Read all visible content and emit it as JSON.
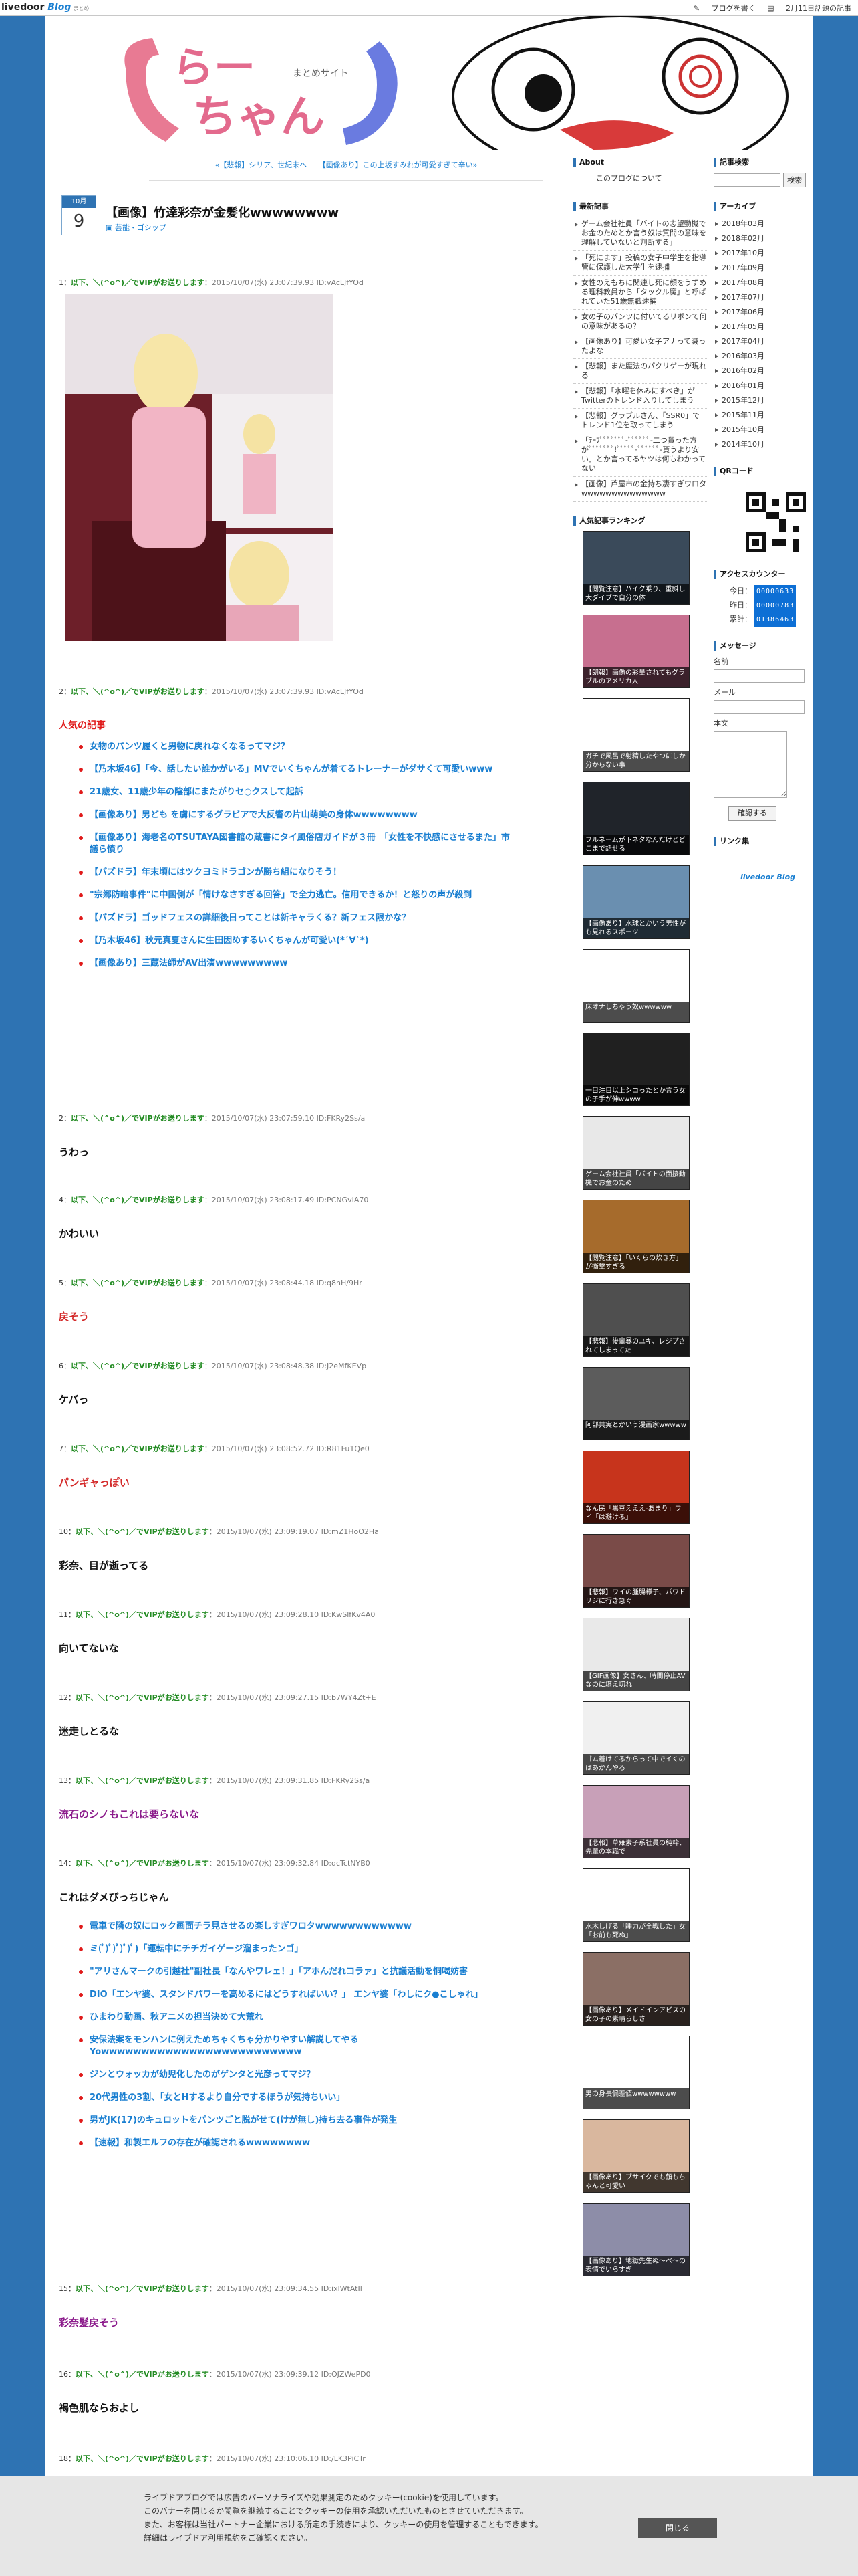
{
  "topbar": {
    "logo_text": "livedoor",
    "logo_blog": "Blog",
    "logo_sub": "まとめ",
    "write": "ブログを書く",
    "date_link": "2月11日話題の記事"
  },
  "header": {
    "title_line1": "らー",
    "title_line2": "ちゃん",
    "subtitle": "まとめサイト"
  },
  "prevnext": {
    "prev": "«【悲報】シリア、世紀末へ",
    "next": "【画像あり】この上坂すみれが可愛すぎて辛い»"
  },
  "article": {
    "month": "10月",
    "day": "9",
    "title": "【画像】竹達彩奈が金髪化wwwwwwww",
    "category": "芸能・ゴシップ"
  },
  "responses": [
    {
      "num": "1：",
      "name": "以下、＼(^o^)／でVIPがお送りします",
      "meta": "：2015/10/07(水) 23:07:39.93 ID:vAcLJfYOd",
      "body": "",
      "color": "#111"
    },
    {
      "num": "2：",
      "name": "以下、＼(^o^)／でVIPがお送りします",
      "meta": "：2015/10/07(水) 23:07:39.93 ID:vAcLJfYOd",
      "body": "",
      "color": "#111"
    },
    {
      "num": "2：",
      "name": "以下、＼(^o^)／でVIPがお送りします",
      "meta": "：2015/10/07(水) 23:07:59.10 ID:FKRy2Ss/a",
      "body": "うわっ",
      "color": "#111"
    },
    {
      "num": "4：",
      "name": "以下、＼(^o^)／でVIPがお送りします",
      "meta": "：2015/10/07(水) 23:08:17.49 ID:PCNGvIA70",
      "body": "かわいい",
      "color": "#111"
    },
    {
      "num": "5：",
      "name": "以下、＼(^o^)／でVIPがお送りします",
      "meta": "：2015/10/07(水) 23:08:44.18 ID:q8nH/9Hr",
      "body": "戻そう",
      "color": "#d42b2b"
    },
    {
      "num": "6：",
      "name": "以下、＼(^o^)／でVIPがお送りします",
      "meta": "：2015/10/07(水) 23:08:48.38 ID:J2eMfKEVp",
      "body": "ケバっ",
      "color": "#111"
    },
    {
      "num": "7：",
      "name": "以下、＼(^o^)／でVIPがお送りします",
      "meta": "：2015/10/07(水) 23:08:52.72 ID:R81Fu1Qe0",
      "body": "パンギャっぽい",
      "color": "#d42b2b"
    },
    {
      "num": "10：",
      "name": "以下、＼(^o^)／でVIPがお送りします",
      "meta": "：2015/10/07(水) 23:09:19.07 ID:mZ1HoO2Ha",
      "body": "彩奈、目が逝ってる",
      "color": "#111"
    },
    {
      "num": "11：",
      "name": "以下、＼(^o^)／でVIPがお送りします",
      "meta": "：2015/10/07(水) 23:09:28.10 ID:KwSlfKv4A0",
      "body": "向いてないな",
      "color": "#111"
    },
    {
      "num": "12：",
      "name": "以下、＼(^o^)／でVIPがお送りします",
      "meta": "：2015/10/07(水) 23:09:27.15 ID:b7WY4Zt+E",
      "body": "迷走しとるな",
      "color": "#111"
    },
    {
      "num": "13：",
      "name": "以下、＼(^o^)／でVIPがお送りします",
      "meta": "：2015/10/07(水) 23:09:31.85 ID:FKRy2Ss/a",
      "body": "流石のシノもこれは要らないな",
      "color": "#8b1a8b"
    },
    {
      "num": "14：",
      "name": "以下、＼(^o^)／でVIPがお送りします",
      "meta": "：2015/10/07(水) 23:09:32.84 ID:qcTctNYB0",
      "body": "これはダメびっちじゃん",
      "color": "#111"
    },
    {
      "num": "15：",
      "name": "以下、＼(^o^)／でVIPがお送りします",
      "meta": "：2015/10/07(水) 23:09:34.55 ID:ixlWtAtIl",
      "body": "彩奈髪戻そう",
      "color": "#8b1a8b"
    },
    {
      "num": "16：",
      "name": "以下、＼(^o^)／でVIPがお送りします",
      "meta": "：2015/10/07(水) 23:09:39.12 ID:OJZWePD0",
      "body": "褐色肌ならおよし",
      "color": "#111"
    },
    {
      "num": "18：",
      "name": "以下、＼(^o^)／でVIPがお送りします",
      "meta": "：2015/10/07(水) 23:10:06.10 ID:/LK3PiCTr",
      "body": "",
      "color": "#111"
    }
  ],
  "popular": {
    "title": "人気の記事",
    "items": [
      "女物のパンツ履くと男物に戻れなくなるってマジ？",
      "【乃木坂46】「今、話したい誰かがいる」MVでいくちゃんが着てるトレーナーがダサくて可愛いwww",
      "21歳女、11歳少年の陰部にまたがりセ○クスして起訴",
      "【画像あり】男ども を虜にするグラビアで大反響の片山萌美の身体wwwwwwww",
      "【画像あり】海老名のTSUTAYA図書館の蔵書にタイ風俗店ガイドが３冊　「女性を不快感にさせるまた」市議ら憤り",
      "【パズドラ】年末頃にはツクヨミドラゴンが勝ち組になりそう！",
      "\"宗郷防暗事件\"に中国側が「情けなさすぎる回答」で全力逃亡。信用できるか！と怒りの声が殺到",
      "【パズドラ】ゴッドフェスの詳細後日ってことは新キャラくる？新フェス限かな？",
      "【乃木坂46】秋元真夏さんに生田因めするいくちゃんが可愛い(*´∀`*)",
      "【画像あり】三蔵法師がAV出演wwwwwwwww"
    ]
  },
  "second_links": [
    "電車で隣の奴にロック画面チラ見させるの楽しすぎワロタwwwwwwwwwwww",
    "ミ(ﾟ)ﾟ)ﾟ)ﾟ)ﾟ)「運転中にチチガイゲージ溜まったンゴ」",
    "\"アリさんマークの引越社\"副社長「なんやワレェ！」「アホんだれコラァ」と抗議活動を恫喝妨害",
    "DIO「エンヤ婆、スタンドパワーを高めるにはどうすればいい？」 エンヤ婆「わしにク●こしゃれ」",
    "ひまわり動画、秋アニメの担当決めて大荒れ",
    "安保法案をモンハンに例えためちゃくちゃ分かりやすい解説してやるYowwwwwwwwwwwwwwwwwwwwwwwww",
    "ジンとウォッカが幼児化したのがゲンタと光彦ってマジ？",
    "20代男性の3割、「女とHするより自分でするほうが気持ちいい」",
    "男がJK(17)のキュロットをパンツごと脱がせて(けが無し)持ち去る事件が発生",
    "【速報】和製エルフの存在が確認されるwwwwwwww"
  ],
  "side1": {
    "about_title": "About",
    "about_text": "このブログについて",
    "recent_title": "最新記事",
    "recent": [
      "ゲーム会社社員「バイトの志望動機でお金のためとか言う奴は質問の意味を理解していないと判断する」",
      "「死にます」投稿の女子中学生を指導管に保護した大学生を逮捕",
      "女性のえもちに関連し死に顔をうずめる理科教員から「タックル魔」と呼ばれていた51歳無職逮捕",
      "女の子のパンツに付いてるリボンて何の意味があるの？",
      "【画像あり】可愛い女子アナって減ったよな",
      "【悲報】また魔法のパクリゲーが現れる",
      "【悲報】「水曜を休みにすべき」がTwitterのトレンド入りしてしまう",
      "【悲報】グラブルさん、「SSR0」でトレンド1位を取ってしまう",
      "「ﾃｰﾌﾟﾟﾟﾟﾟﾟﾟ-ﾟﾟﾟﾟﾟﾟ-二つ貰った方がﾟﾟﾟﾟﾟﾟﾟ!ﾟﾟﾟﾟﾟ-ﾟﾟﾟﾟﾟﾟ-貰うより安い」とか言ってるヤツは何もわかってない",
      "【画像】芦屋市の金持ち凄すぎワロタwwwwwwwwwwwwww"
    ],
    "popular_title": "人気記事ランキング",
    "thumbs": [
      "【閲覧注意】バイク乗り、重斜し大ダイブで自分の体",
      "【朗報】画像の彩量されてもグラブルのアメリカ人",
      "ガチで風呂で射精したやつにしか分からない事",
      "フルネームが下ネタなんだけどどこまで話せる",
      "【画像あり】水球とかいう男性がも見れるスポーツ",
      "床オナしちゃう奴wwwwww",
      "一目注目以上シコったとか言う女の子手が伸wwww",
      "ゲーム会社社員「バイトの面接動機でお金のため",
      "【閲覧注意】「いくらの炊き方」が衝撃すぎる",
      "【悲報】後輩暴のユキ、レジプされてしまってた",
      "阿部共実とかいう漫画家wwwww",
      "なん民「黒豆えええ-あまり」ワイ「は避ける」",
      "【悲報】ワイの腫腸様子、パワドリジに行き急ぐ",
      "【GIF画像】女さん、時間停止AVなのに堪え切れ",
      "ゴム着けてるからって中でイくのはあかんやろ",
      "【悲報】草薙素子系社員の純粋、先輩の本職で",
      "水木しげる「睡力が全戦した」女「お前も死ぬ」",
      "【画像あり】メイドインアビスの女の子の素晴らしさ",
      "男の身長偏差値wwwwwwww",
      "【画像あり】ブサイクでも顔もちゃんと可愛い",
      "【画像あり】地獄先生ぬ～べ～の表情でいらすぎ"
    ]
  },
  "side2": {
    "search_title": "記事検索",
    "search_button": "検索",
    "archive_title": "アーカイブ",
    "archives": [
      "2018年03月",
      "2018年02月",
      "2017年10月",
      "2017年09月",
      "2017年08月",
      "2017年07月",
      "2017年06月",
      "2017年05月",
      "2017年04月",
      "2016年03月",
      "2016年02月",
      "2016年01月",
      "2015年12月",
      "2015年11月",
      "2015年10月",
      "2014年10月"
    ],
    "qr_title": "QRコード",
    "counter_title": "アクセスカウンター",
    "counter": [
      {
        "label": "今日：",
        "value": "00000633"
      },
      {
        "label": "昨日：",
        "value": "00000783"
      },
      {
        "label": "累計：",
        "value": "01386463"
      }
    ],
    "message_title": "メッセージ",
    "name_label": "名前",
    "mail_label": "メール",
    "body_label": "本文",
    "confirm_button": "確認する",
    "links_title": "リンク集",
    "footer_logo": "livedoor Blog"
  },
  "cookie": {
    "line1": "ライブドアブログでは広告のパーソナライズや効果測定のためクッキー(cookie)を使用しています。",
    "line2": "このバナーを閉じるか閲覧を継続することでクッキーの使用を承認いただいたものとさせていただきます。",
    "line3": "また、お客様は当社パートナー企業における所定の手続きにより、クッキーの使用を管理することもできます。",
    "line4": "詳細はライブドア利用規約をご確認ください。",
    "close": "閉じる"
  }
}
